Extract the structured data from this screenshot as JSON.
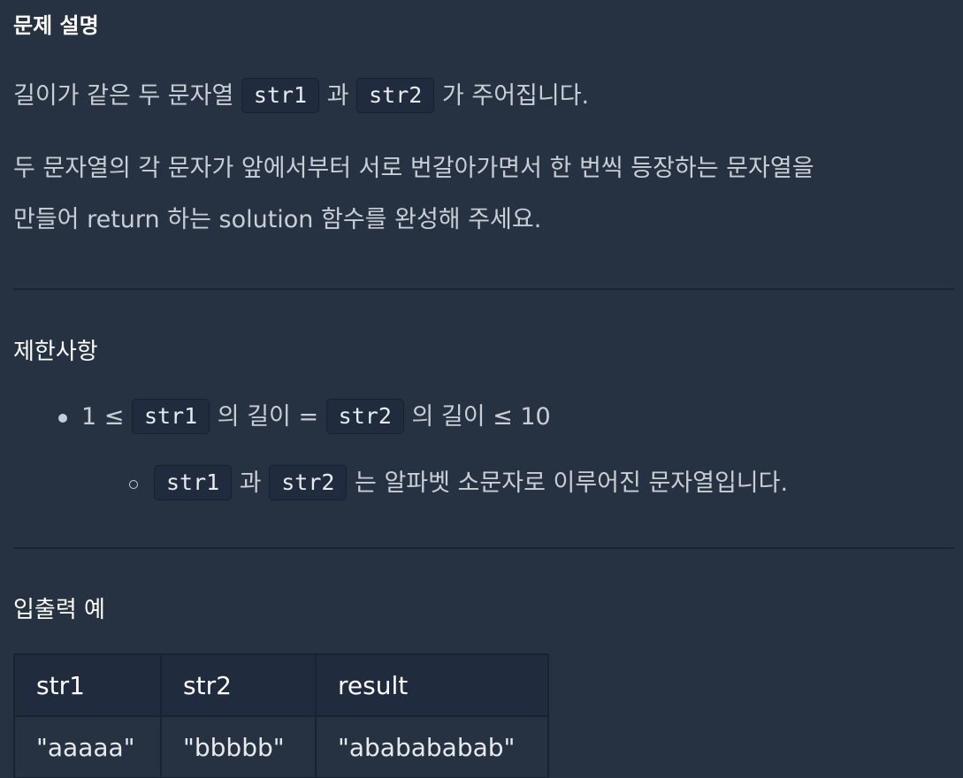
{
  "description": {
    "title": "문제 설명",
    "line1": {
      "text_a": "길이가 같은 두 문자열 ",
      "code_a": "str1",
      "text_b": " 과 ",
      "code_b": "str2",
      "text_c": " 가 주어집니다."
    },
    "line2": "두 문자열의 각 문자가 앞에서부터 서로 번갈아가면서 한 번씩 등장하는 문자열을",
    "line3": "만들어 return 하는 solution 함수를 완성해 주세요."
  },
  "constraints": {
    "title": "제한사항",
    "item1": {
      "prefix": "1 ≤ ",
      "code_a": "str1",
      "mid": " 의 길이 = ",
      "code_b": "str2",
      "suffix": " 의 길이 ≤ 10"
    },
    "subitem1": {
      "code_a": "str1",
      "mid": " 과 ",
      "code_b": "str2",
      "suffix": " 는 알파벳 소문자로 이루어진 문자열입니다."
    }
  },
  "examples": {
    "title": "입출력 예",
    "columns": [
      "str1",
      "str2",
      "result"
    ],
    "rows": [
      [
        "\"aaaaa\"",
        "\"bbbbb\"",
        "\"ababababab\""
      ]
    ]
  }
}
